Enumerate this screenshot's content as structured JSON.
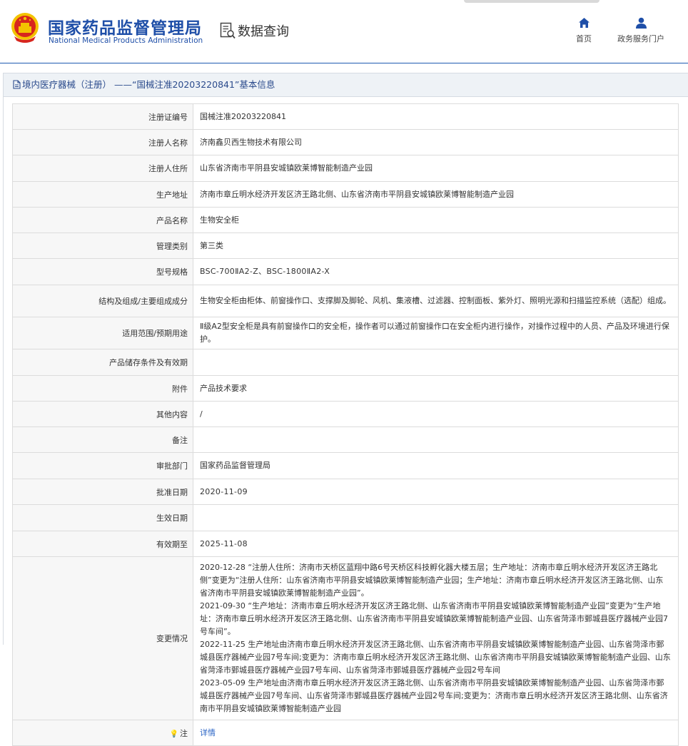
{
  "header": {
    "org_cn": "国家药品监督管理局",
    "org_en": "National Medical Products Administration",
    "query_title": "数据查询",
    "nav": [
      {
        "label": "首页",
        "icon": "home-icon"
      },
      {
        "label": "政务服务门户",
        "icon": "user-icon"
      }
    ]
  },
  "panel": {
    "title": "境内医疗器械（注册） ——“国械注准20203220841”基本信息"
  },
  "rows": [
    {
      "label": "注册证编号",
      "value": "国械注准20203220841"
    },
    {
      "label": "注册人名称",
      "value": "济南鑫贝西生物技术有限公司"
    },
    {
      "label": "注册人住所",
      "value": "山东省济南市平阴县安城镇欧莱博智能制造产业园"
    },
    {
      "label": "生产地址",
      "value": "济南市章丘明水经济开发区济王路北侧、山东省济南市平阴县安城镇欧莱博智能制造产业园"
    },
    {
      "label": "产品名称",
      "value": "生物安全柜"
    },
    {
      "label": "管理类别",
      "value": "第三类"
    },
    {
      "label": "型号规格",
      "value": "BSC-700ⅡA2-Z、BSC-1800ⅡA2-X"
    },
    {
      "label": "结构及组成/主要组成成分",
      "value": "生物安全柜由柜体、前窗操作口、支撑脚及脚轮、风机、集液槽、过滤器、控制面板、紫外灯、照明光源和扫描监控系统（选配）组成。"
    },
    {
      "label": "适用范围/预期用途",
      "value": "Ⅱ级A2型安全柜是具有前窗操作口的安全柜，操作者可以通过前窗操作口在安全柜内进行操作，对操作过程中的人员、产品及环境进行保护。"
    },
    {
      "label": "产品储存条件及有效期",
      "value": ""
    },
    {
      "label": "附件",
      "value": "产品技术要求"
    },
    {
      "label": "其他内容",
      "value": "/"
    },
    {
      "label": "备注",
      "value": ""
    },
    {
      "label": "审批部门",
      "value": "国家药品监督管理局"
    },
    {
      "label": "批准日期",
      "value": "2020-11-09"
    },
    {
      "label": "生效日期",
      "value": ""
    },
    {
      "label": "有效期至",
      "value": "2025-11-08"
    }
  ],
  "changes": {
    "label": "变更情况",
    "entries": [
      "2020-12-28 “注册人住所：济南市天桥区蓝翔中路6号天桥区科技孵化器大楼五层；生产地址：济南市章丘明水经济开发区济王路北侧”变更为“注册人住所：山东省济南市平阴县安城镇欧莱博智能制造产业园；生产地址：济南市章丘明水经济开发区济王路北侧、山东省济南市平阴县安城镇欧莱博智能制造产业园”。",
      "2021-09-30 “生产地址：济南市章丘明水经济开发区济王路北侧、山东省济南市平阴县安城镇欧莱博智能制造产业园”变更为“生产地址：济南市章丘明水经济开发区济王路北侧、山东省济南市平阴县安城镇欧莱博智能制造产业园、山东省菏泽市鄄城县医疗器械产业园7号车间”。",
      "2022-11-25 生产地址由济南市章丘明水经济开发区济王路北侧、山东省济南市平阴县安城镇欧莱博智能制造产业园、山东省菏泽市鄄城县医疗器械产业园7号车间;变更为：济南市章丘明水经济开发区济王路北侧、山东省济南市平阴县安城镇欧莱博智能制造产业园、山东省菏泽市鄄城县医疗器械产业园7号车间、山东省菏泽市鄄城县医疗器械产业园2号车间",
      "2023-05-09 生产地址由济南市章丘明水经济开发区济王路北侧、山东省济南市平阴县安城镇欧莱博智能制造产业园、山东省菏泽市鄄城县医疗器械产业园7号车间、山东省菏泽市鄄城县医疗器械产业园2号车间;变更为：济南市章丘明水经济开发区济王路北侧、山东省济南市平阴县安城镇欧莱博智能制造产业园"
    ]
  },
  "note_row": {
    "label": "注",
    "icon": "bulb-icon",
    "value": "详情"
  },
  "colors": {
    "brand_blue": "#1f4fa8",
    "emblem_red": "#d7261e",
    "emblem_gold": "#f3c300",
    "link": "#2a64c5"
  }
}
